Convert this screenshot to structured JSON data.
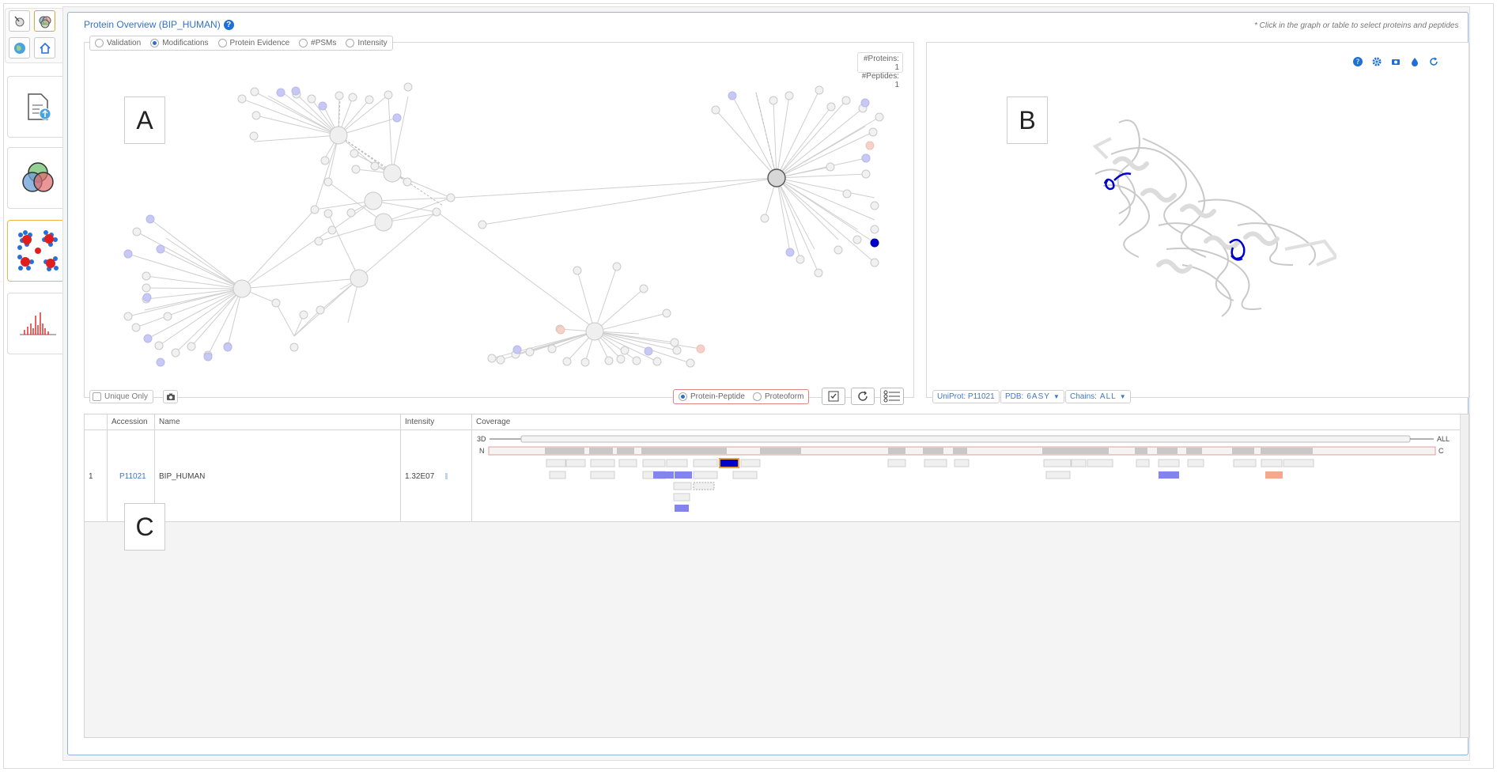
{
  "nav": {
    "mini_icons": [
      "search-tool-icon",
      "venn-circles-icon",
      "globe-icon",
      "home-icon"
    ],
    "tiles": [
      "document-upload-icon",
      "venn-diagram-icon",
      "network-icon",
      "spectrum-icon"
    ]
  },
  "header": {
    "title": "Protein Overview (BIP_HUMAN)",
    "help": "?",
    "hint": "* Click in the graph or table to select proteins and peptides"
  },
  "panel_a": {
    "color_options": [
      {
        "label": "Validation",
        "selected": false
      },
      {
        "label": "Modifications",
        "selected": true
      },
      {
        "label": "Protein Evidence",
        "selected": false
      },
      {
        "label": "#PSMs",
        "selected": false
      },
      {
        "label": "Intensity",
        "selected": false
      }
    ],
    "counts": {
      "proteins": "#Proteins: 1",
      "peptides": "#Peptides: 1"
    },
    "label": "A",
    "unique_only": "Unique Only",
    "view_modes": [
      {
        "label": "Protein-Peptide",
        "selected": true
      },
      {
        "label": "Proteoform",
        "selected": false
      }
    ]
  },
  "panel_b": {
    "label": "B",
    "uniprot": "UniProt: P11021",
    "pdb_label": "PDB:",
    "pdb_value": "6ASY",
    "chains_label": "Chains:",
    "chains_value": "ALL"
  },
  "table": {
    "label": "C",
    "columns": [
      "",
      "Accession",
      "Name",
      "Intensity",
      "Coverage"
    ],
    "rows": [
      {
        "index": "1",
        "accession": "P11021",
        "name": "BIP_HUMAN",
        "intensity": "1.32E07"
      }
    ],
    "coverage": {
      "track_3d": "3D",
      "track_all": "ALL",
      "n_term": "N",
      "c_term": "C"
    }
  },
  "colors": {
    "accent": "#3473c9",
    "modified_peptide": "#8484f0",
    "selected_peptide": "#0000cc",
    "highlight_border": "#f0a030",
    "alt_modification": "#f4a890"
  }
}
